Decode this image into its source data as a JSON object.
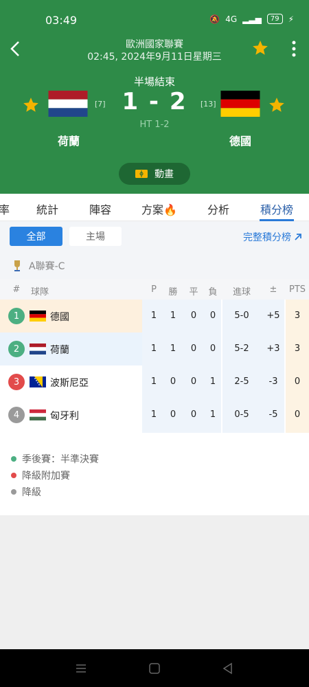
{
  "status_bar": {
    "time": "03:49",
    "network": "4G",
    "battery": "79"
  },
  "match": {
    "league": "歐洲國家聯賽",
    "datetime": "02:45, 2024年9月11日星期三",
    "phase": "半場結束",
    "score": "1 - 2",
    "half_time": "HT 1-2",
    "home": {
      "name": "荷蘭",
      "rank": "[7]"
    },
    "away": {
      "name": "德國",
      "rank": "[13]"
    },
    "animation_label": "動畫"
  },
  "tabs": [
    {
      "label": "率"
    },
    {
      "label": "統計"
    },
    {
      "label": "陣容"
    },
    {
      "label": "方案"
    },
    {
      "label": "分析"
    },
    {
      "label": "積分榜"
    }
  ],
  "filters": {
    "all": "全部",
    "home": "主場",
    "full_table": "完整積分榜"
  },
  "group": "A聯賽-C",
  "table": {
    "headers": {
      "pos": "#",
      "team": "球隊",
      "p": "P",
      "w": "勝",
      "d": "平",
      "l": "負",
      "goals": "進球",
      "diff": "±",
      "pts": "PTS"
    },
    "rows": [
      {
        "pos": "1",
        "team": "德國",
        "p": "1",
        "w": "1",
        "d": "0",
        "l": "0",
        "goals": "5-0",
        "diff": "+5",
        "pts": "3",
        "status_color": "#4caf82"
      },
      {
        "pos": "2",
        "team": "荷蘭",
        "p": "1",
        "w": "1",
        "d": "0",
        "l": "0",
        "goals": "5-2",
        "diff": "+3",
        "pts": "3",
        "status_color": "#4caf82"
      },
      {
        "pos": "3",
        "team": "波斯尼亞",
        "p": "1",
        "w": "0",
        "d": "0",
        "l": "1",
        "goals": "2-5",
        "diff": "-3",
        "pts": "0",
        "status_color": "#e24b4b"
      },
      {
        "pos": "4",
        "team": "匈牙利",
        "p": "1",
        "w": "0",
        "d": "0",
        "l": "1",
        "goals": "0-5",
        "diff": "-5",
        "pts": "0",
        "status_color": "#9a9a9a"
      }
    ]
  },
  "legend": [
    {
      "label": "季後賽：半準決賽",
      "color": "#4caf82"
    },
    {
      "label": "降級附加賽",
      "color": "#e24b4b"
    },
    {
      "label": "降級",
      "color": "#9a9a9a"
    }
  ],
  "colors": {
    "primary_green": "#2e8b48",
    "accent_blue": "#2a82e0",
    "star": "#f4b400"
  }
}
